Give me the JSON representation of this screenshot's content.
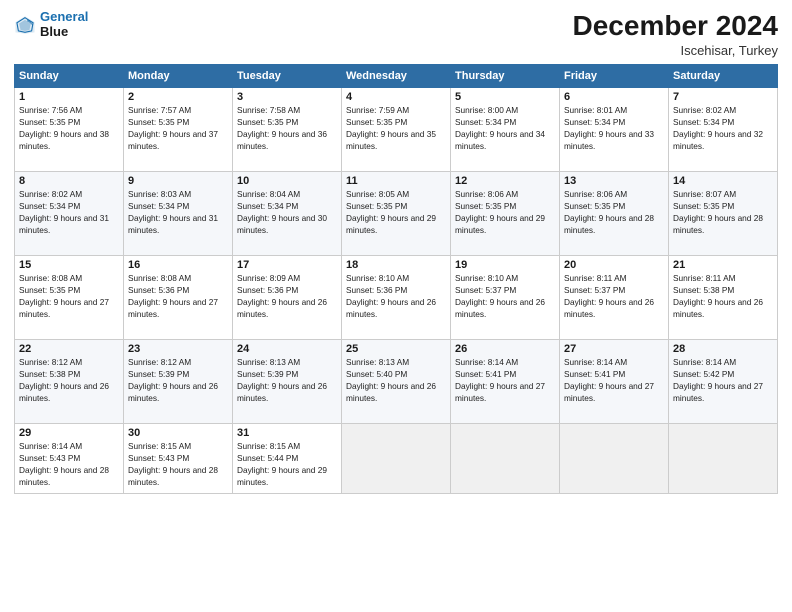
{
  "logo": {
    "line1": "General",
    "line2": "Blue"
  },
  "header": {
    "month": "December 2024",
    "location": "Iscehisar, Turkey"
  },
  "weekdays": [
    "Sunday",
    "Monday",
    "Tuesday",
    "Wednesday",
    "Thursday",
    "Friday",
    "Saturday"
  ],
  "weeks": [
    [
      {
        "day": "1",
        "sunrise": "7:56 AM",
        "sunset": "5:35 PM",
        "daylight": "9 hours and 38 minutes."
      },
      {
        "day": "2",
        "sunrise": "7:57 AM",
        "sunset": "5:35 PM",
        "daylight": "9 hours and 37 minutes."
      },
      {
        "day": "3",
        "sunrise": "7:58 AM",
        "sunset": "5:35 PM",
        "daylight": "9 hours and 36 minutes."
      },
      {
        "day": "4",
        "sunrise": "7:59 AM",
        "sunset": "5:35 PM",
        "daylight": "9 hours and 35 minutes."
      },
      {
        "day": "5",
        "sunrise": "8:00 AM",
        "sunset": "5:34 PM",
        "daylight": "9 hours and 34 minutes."
      },
      {
        "day": "6",
        "sunrise": "8:01 AM",
        "sunset": "5:34 PM",
        "daylight": "9 hours and 33 minutes."
      },
      {
        "day": "7",
        "sunrise": "8:02 AM",
        "sunset": "5:34 PM",
        "daylight": "9 hours and 32 minutes."
      }
    ],
    [
      {
        "day": "8",
        "sunrise": "8:02 AM",
        "sunset": "5:34 PM",
        "daylight": "9 hours and 31 minutes."
      },
      {
        "day": "9",
        "sunrise": "8:03 AM",
        "sunset": "5:34 PM",
        "daylight": "9 hours and 31 minutes."
      },
      {
        "day": "10",
        "sunrise": "8:04 AM",
        "sunset": "5:34 PM",
        "daylight": "9 hours and 30 minutes."
      },
      {
        "day": "11",
        "sunrise": "8:05 AM",
        "sunset": "5:35 PM",
        "daylight": "9 hours and 29 minutes."
      },
      {
        "day": "12",
        "sunrise": "8:06 AM",
        "sunset": "5:35 PM",
        "daylight": "9 hours and 29 minutes."
      },
      {
        "day": "13",
        "sunrise": "8:06 AM",
        "sunset": "5:35 PM",
        "daylight": "9 hours and 28 minutes."
      },
      {
        "day": "14",
        "sunrise": "8:07 AM",
        "sunset": "5:35 PM",
        "daylight": "9 hours and 28 minutes."
      }
    ],
    [
      {
        "day": "15",
        "sunrise": "8:08 AM",
        "sunset": "5:35 PM",
        "daylight": "9 hours and 27 minutes."
      },
      {
        "day": "16",
        "sunrise": "8:08 AM",
        "sunset": "5:36 PM",
        "daylight": "9 hours and 27 minutes."
      },
      {
        "day": "17",
        "sunrise": "8:09 AM",
        "sunset": "5:36 PM",
        "daylight": "9 hours and 26 minutes."
      },
      {
        "day": "18",
        "sunrise": "8:10 AM",
        "sunset": "5:36 PM",
        "daylight": "9 hours and 26 minutes."
      },
      {
        "day": "19",
        "sunrise": "8:10 AM",
        "sunset": "5:37 PM",
        "daylight": "9 hours and 26 minutes."
      },
      {
        "day": "20",
        "sunrise": "8:11 AM",
        "sunset": "5:37 PM",
        "daylight": "9 hours and 26 minutes."
      },
      {
        "day": "21",
        "sunrise": "8:11 AM",
        "sunset": "5:38 PM",
        "daylight": "9 hours and 26 minutes."
      }
    ],
    [
      {
        "day": "22",
        "sunrise": "8:12 AM",
        "sunset": "5:38 PM",
        "daylight": "9 hours and 26 minutes."
      },
      {
        "day": "23",
        "sunrise": "8:12 AM",
        "sunset": "5:39 PM",
        "daylight": "9 hours and 26 minutes."
      },
      {
        "day": "24",
        "sunrise": "8:13 AM",
        "sunset": "5:39 PM",
        "daylight": "9 hours and 26 minutes."
      },
      {
        "day": "25",
        "sunrise": "8:13 AM",
        "sunset": "5:40 PM",
        "daylight": "9 hours and 26 minutes."
      },
      {
        "day": "26",
        "sunrise": "8:14 AM",
        "sunset": "5:41 PM",
        "daylight": "9 hours and 27 minutes."
      },
      {
        "day": "27",
        "sunrise": "8:14 AM",
        "sunset": "5:41 PM",
        "daylight": "9 hours and 27 minutes."
      },
      {
        "day": "28",
        "sunrise": "8:14 AM",
        "sunset": "5:42 PM",
        "daylight": "9 hours and 27 minutes."
      }
    ],
    [
      {
        "day": "29",
        "sunrise": "8:14 AM",
        "sunset": "5:43 PM",
        "daylight": "9 hours and 28 minutes."
      },
      {
        "day": "30",
        "sunrise": "8:15 AM",
        "sunset": "5:43 PM",
        "daylight": "9 hours and 28 minutes."
      },
      {
        "day": "31",
        "sunrise": "8:15 AM",
        "sunset": "5:44 PM",
        "daylight": "9 hours and 29 minutes."
      },
      null,
      null,
      null,
      null
    ]
  ]
}
